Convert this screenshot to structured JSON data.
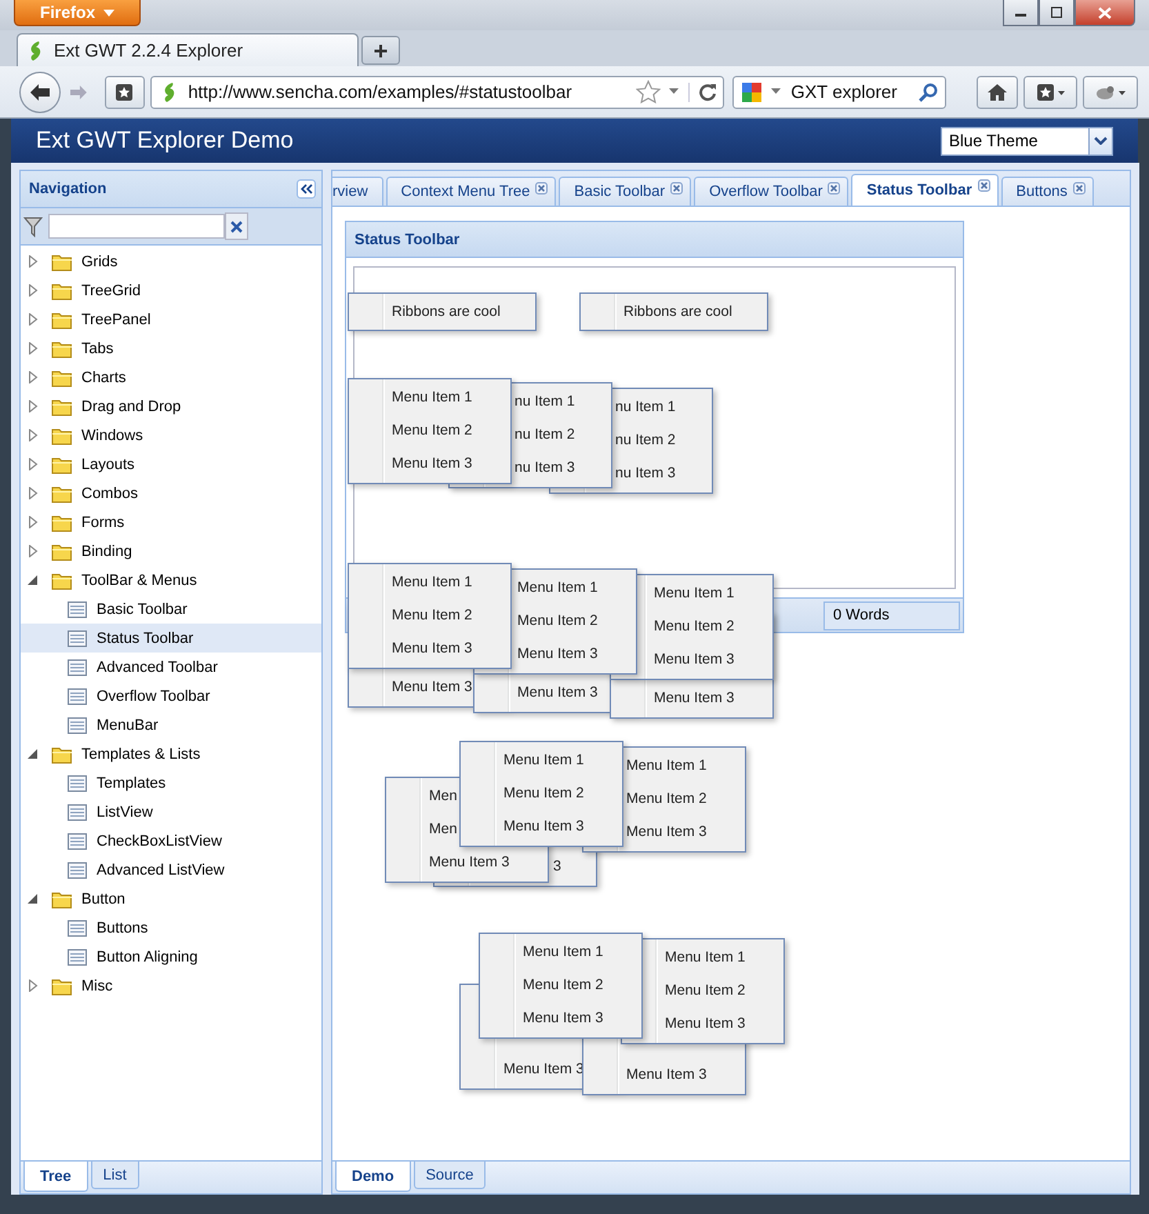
{
  "browser": {
    "app_button": "Firefox",
    "tabs": [
      {
        "label": "Ext GWT 2.2.4 Explorer",
        "selected": true
      }
    ],
    "new_tab": "+",
    "address": "http://www.sencha.com/examples/#statustoolbar",
    "search": "GXT explorer"
  },
  "app": {
    "title": "Ext GWT Explorer Demo",
    "theme": "Blue Theme"
  },
  "navigation": {
    "title": "Navigation",
    "tree": [
      {
        "kind": "folder",
        "label": "Grids",
        "expanded": false,
        "selected": false
      },
      {
        "kind": "folder",
        "label": "TreeGrid",
        "expanded": false,
        "selected": false
      },
      {
        "kind": "folder",
        "label": "TreePanel",
        "expanded": false,
        "selected": false
      },
      {
        "kind": "folder",
        "label": "Tabs",
        "expanded": false,
        "selected": false
      },
      {
        "kind": "folder",
        "label": "Charts",
        "expanded": false,
        "selected": false
      },
      {
        "kind": "folder",
        "label": "Drag and Drop",
        "expanded": false,
        "selected": false
      },
      {
        "kind": "folder",
        "label": "Windows",
        "expanded": false,
        "selected": false
      },
      {
        "kind": "folder",
        "label": "Layouts",
        "expanded": false,
        "selected": false
      },
      {
        "kind": "folder",
        "label": "Combos",
        "expanded": false,
        "selected": false
      },
      {
        "kind": "folder",
        "label": "Forms",
        "expanded": false,
        "selected": false
      },
      {
        "kind": "folder",
        "label": "Binding",
        "expanded": false,
        "selected": false
      },
      {
        "kind": "folder",
        "label": "ToolBar & Menus",
        "expanded": true,
        "selected": false,
        "children": [
          {
            "kind": "page",
            "label": "Basic Toolbar",
            "selected": false
          },
          {
            "kind": "page",
            "label": "Status Toolbar",
            "selected": true
          },
          {
            "kind": "page",
            "label": "Advanced Toolbar",
            "selected": false
          },
          {
            "kind": "page",
            "label": "Overflow Toolbar",
            "selected": false
          },
          {
            "kind": "page",
            "label": "MenuBar",
            "selected": false
          }
        ]
      },
      {
        "kind": "folder",
        "label": "Templates & Lists",
        "expanded": true,
        "selected": false,
        "children": [
          {
            "kind": "page",
            "label": "Templates",
            "selected": false
          },
          {
            "kind": "page",
            "label": "ListView",
            "selected": false
          },
          {
            "kind": "page",
            "label": "CheckBoxListView",
            "selected": false
          },
          {
            "kind": "page",
            "label": "Advanced ListView",
            "selected": false
          }
        ]
      },
      {
        "kind": "folder",
        "label": "Button",
        "expanded": true,
        "selected": false,
        "children": [
          {
            "kind": "page",
            "label": "Buttons",
            "selected": false
          },
          {
            "kind": "page",
            "label": "Button Aligning",
            "selected": false
          }
        ]
      },
      {
        "kind": "folder",
        "label": "Misc",
        "expanded": false,
        "selected": false
      }
    ],
    "bottom_tabs": [
      {
        "label": "Tree",
        "selected": true
      },
      {
        "label": "List",
        "selected": false
      }
    ]
  },
  "content": {
    "tabs": [
      {
        "label": "rview",
        "selected": false,
        "closable": false
      },
      {
        "label": "Context Menu Tree",
        "selected": false,
        "closable": true
      },
      {
        "label": "Basic Toolbar",
        "selected": false,
        "closable": true
      },
      {
        "label": "Overflow Toolbar",
        "selected": false,
        "closable": true
      },
      {
        "label": "Status Toolbar",
        "selected": true,
        "closable": true
      },
      {
        "label": "Buttons",
        "selected": false,
        "closable": true
      }
    ],
    "panel": {
      "title": "Status Toolbar",
      "status": "0 Words",
      "ribbons": [
        "Ribbons are cool",
        "Ribbons are cool"
      ],
      "menus": [
        {
          "items": [
            "Menu Item 1",
            "Menu Item 2",
            "Menu Item 3"
          ]
        },
        {
          "items": [
            "nu Item 1",
            "nu Item 2",
            "nu Item 3"
          ]
        },
        {
          "items": [
            "nu Item 1",
            "nu Item 2",
            "nu Item 3"
          ]
        },
        {
          "items": [
            "Menu Item 1",
            "Menu Item 2",
            "Menu Item 3"
          ]
        },
        {
          "items": [
            "Menu Item 1",
            "Menu Item 2",
            "Menu Item 3"
          ]
        },
        {
          "items": [
            "Menu Item 1",
            "Menu Item 2",
            "Menu Item 3"
          ]
        },
        {
          "items": [
            "Menu Item 3"
          ]
        },
        {
          "items": [
            "Menu Item 3"
          ]
        },
        {
          "items": [
            "Menu Item 3"
          ]
        },
        {
          "items": [
            "Menu Item 1",
            "Menu Item 2",
            "Menu Item 3"
          ]
        },
        {
          "items": [
            "Menu Item 1",
            "Menu Item 2",
            "Menu Item 3"
          ]
        },
        {
          "items": [
            "Men",
            "Men",
            "Menu Item 3"
          ]
        },
        {
          "items": [
            "3"
          ]
        },
        {
          "items": [
            "Menu Item 1",
            "Menu Item 2",
            "Menu Item 3"
          ]
        },
        {
          "items": [
            "Menu Item 1",
            "Menu Item 2",
            "Menu Item 3"
          ]
        },
        {
          "items": [
            "Menu Item 3"
          ]
        },
        {
          "items": [
            "Menu Item 3"
          ]
        }
      ]
    },
    "bottom_tabs": [
      {
        "label": "Demo",
        "selected": true
      },
      {
        "label": "Source",
        "selected": false
      }
    ]
  }
}
